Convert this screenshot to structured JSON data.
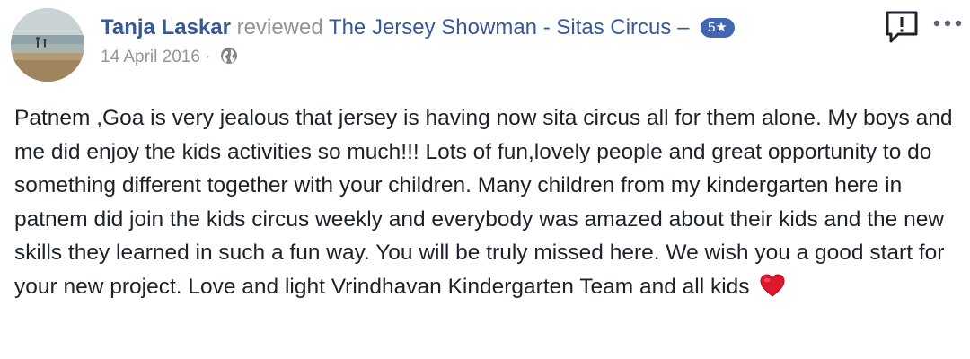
{
  "post": {
    "author": "Tanja Laskar",
    "verb": "reviewed",
    "page_name": "The Jersey Showman - Sitas Circus",
    "dash": "–",
    "rating_label": "5★",
    "date": "14 April 2016",
    "separator": "·",
    "privacy_icon": "globe-icon",
    "review_text": "Patnem ,Goa is very jealous that jersey is having now sita circus all for them alone. My boys and me did enjoy the kids activities so much!!! Lots of fun,lovely people and great opportunity to do something different together with your children. Many children from my kindergarten here in patnem did join the kids circus weekly and everybody was amazed about their kids and the new skills they learned in such a fun way. You will be truly missed here. We wish you a good start for your new project. Love and light Vrindhavan Kindergarten Team and all kids",
    "end_emoji": "heart-icon"
  },
  "actions": {
    "report_icon": "report-icon",
    "more_icon": "more-options-icon"
  },
  "colors": {
    "link": "#365899",
    "muted": "#90949c",
    "badge": "#4267b2",
    "text": "#1d2129",
    "heart": "#e0182d"
  }
}
